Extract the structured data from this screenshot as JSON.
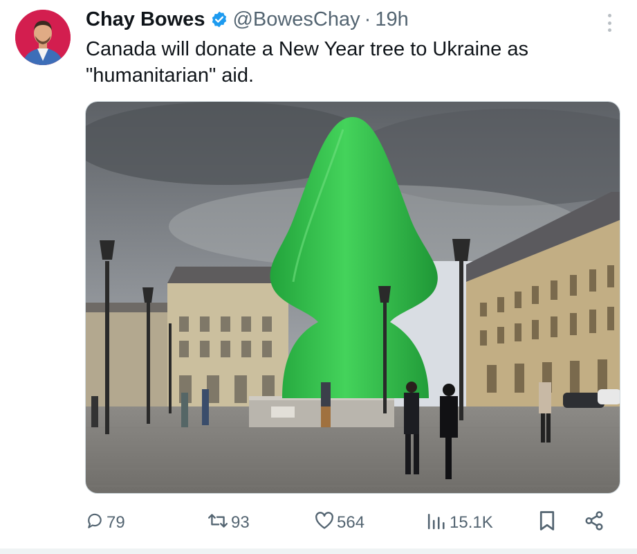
{
  "author": {
    "name": "Chay Bowes",
    "handle": "@BowesChay",
    "separator": "·",
    "time": "19h",
    "verified": true
  },
  "tweet": {
    "text": "Canada will donate a New Year tree to Ukraine as \"humanitarian\" aid."
  },
  "media": {
    "description_icon": "photo"
  },
  "actions": {
    "replies": "79",
    "retweets": "93",
    "likes": "564",
    "views": "15.1K"
  },
  "colors": {
    "accent": "#1d9bf0",
    "muted": "#536471",
    "text": "#0f1419",
    "tree_green": "#2fbe4a"
  },
  "icons": [
    "more-icon",
    "verified-icon",
    "reply-icon",
    "retweet-icon",
    "like-icon",
    "views-icon",
    "bookmark-icon",
    "share-icon"
  ]
}
